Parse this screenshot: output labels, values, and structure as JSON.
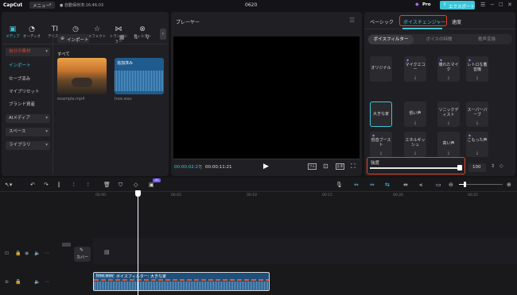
{
  "app": {
    "logo": "CapCut",
    "menu": "メニュー",
    "autosave": "自動保存済:16:46:03",
    "title": "0620",
    "pro": "Pro",
    "export": "エクスポート"
  },
  "colors": {
    "accent": "#3ec6d8",
    "highlight": "#e0432a",
    "pro": "#b56bff"
  },
  "toolbar": [
    {
      "label": "メディア",
      "icon": "media-icon"
    },
    {
      "label": "オーディオ",
      "icon": "audio-icon"
    },
    {
      "label": "テキスト",
      "icon": "text-icon"
    },
    {
      "label": "ステッカー",
      "icon": "sticker-icon"
    },
    {
      "label": "エフェクト",
      "icon": "effect-icon"
    },
    {
      "label": "トランジション",
      "icon": "transition-icon"
    },
    {
      "label": "フィルター",
      "icon": "filter-icon"
    }
  ],
  "media": {
    "side": [
      "自分の素材",
      "インポート",
      "セーブ済み",
      "マイプリセット",
      "ブランド資産",
      "AIメディア",
      "スペース",
      "ライブラリ"
    ],
    "import_button": "インポート",
    "all_label": "すべて",
    "files": [
      {
        "name": "example.mp4"
      },
      {
        "name": "tree.wav",
        "overlay": "追加済み"
      }
    ]
  },
  "player": {
    "title": "プレーヤー",
    "time_current": "00:00:02:27",
    "time_total": "00:00:11:21",
    "btn_full": "フル",
    "btn_ratio": "比率"
  },
  "right": {
    "tabs": [
      "ベーシック",
      "ボイスチェンジャー",
      "速度"
    ],
    "subtabs": [
      "ボイスフィルター",
      "ボイスの特徴",
      "歌声変換"
    ],
    "cells": [
      [
        "オリジナル",
        "マイクエコー",
        "壊れたマイク",
        "レトロな蓄音機"
      ],
      [
        "大きな家",
        "低い声",
        "ソニックディスト",
        "スーパーバーブ"
      ],
      [
        "低音ブースト",
        "エネルギッシュ",
        "高い声",
        "こもった声"
      ]
    ],
    "strength_label": "強度",
    "strength_value": "100"
  },
  "timeline": {
    "ruler": [
      "00:00",
      "00:05",
      "00:10",
      "00:15",
      "00:20",
      "00:25"
    ],
    "cover": "カバー",
    "clip_name": "tree.wav",
    "clip_label": "ボイスフィルター: 大きな家",
    "ai_badge": "AI"
  }
}
